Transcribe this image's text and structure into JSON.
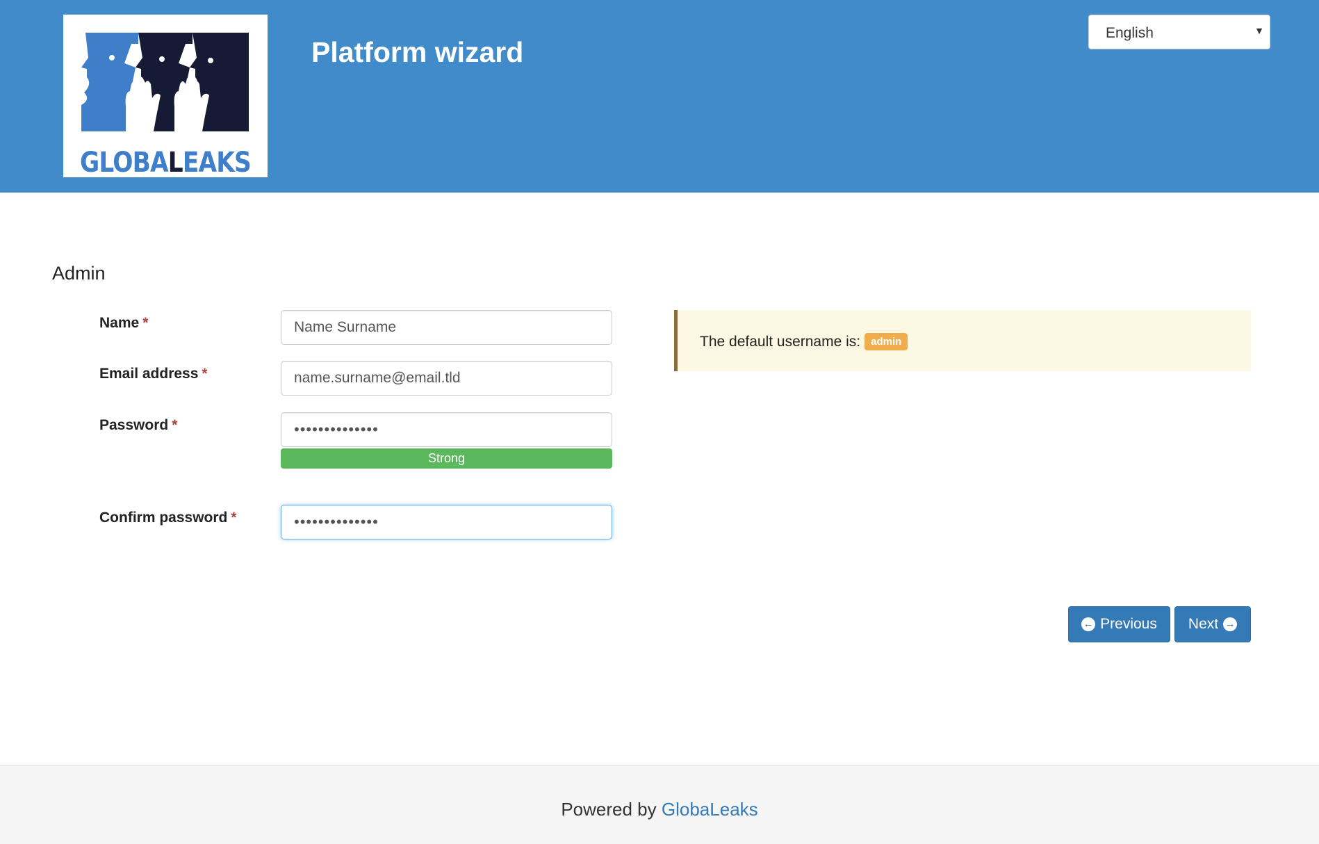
{
  "header": {
    "title": "Platform wizard",
    "logo_text_primary": "GLOBA",
    "logo_text_dark": "L",
    "logo_text_secondary": "EAKS",
    "language": "English",
    "colors": {
      "background": "#428bca",
      "logo_blue": "#3f7fc9",
      "logo_dark": "#161a35"
    }
  },
  "section": {
    "title": "Admin"
  },
  "form": {
    "required_mark": "*",
    "name": {
      "label": "Name",
      "value": "Name Surname"
    },
    "email": {
      "label": "Email address",
      "value": "name.surname@email.tld"
    },
    "password": {
      "label": "Password",
      "value": "••••••••••••••",
      "strength": "Strong"
    },
    "confirm_password": {
      "label": "Confirm password",
      "value": "••••••••••••••"
    }
  },
  "info": {
    "text": "The default username is:",
    "badge": "admin",
    "colors": {
      "background": "#fcf8e3",
      "border": "#8a6d3b",
      "badge": "#f0ad4e"
    }
  },
  "buttons": {
    "previous": {
      "label": "Previous",
      "icon": "arrow-circle-left-icon"
    },
    "next": {
      "label": "Next",
      "icon": "arrow-circle-right-icon"
    },
    "color": "#337ab7"
  },
  "footer": {
    "prefix": "Powered by",
    "link": "GlobaLeaks"
  }
}
